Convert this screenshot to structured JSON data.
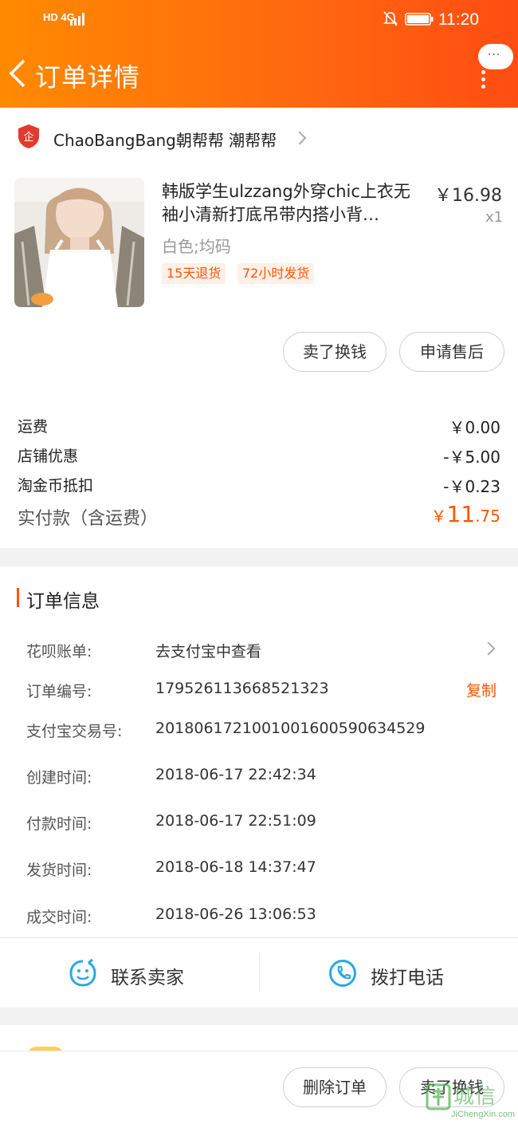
{
  "status_bar": {
    "left_text": "HD 4G",
    "time": "11:20"
  },
  "header": {
    "title": "订单详情",
    "more_label": "···"
  },
  "shop": {
    "name": "ChaoBangBang朝帮帮 潮帮帮"
  },
  "product": {
    "title": "韩版学生ulzzang外穿chic上衣无袖小清新打底吊带内搭小背…",
    "price": "￥16.98",
    "qty": "x1",
    "sku": "白色;均码",
    "tags": [
      "15天退货",
      "72小时发货"
    ]
  },
  "product_actions": [
    "卖了换钱",
    "申请售后"
  ],
  "fees": [
    {
      "label": "运费",
      "value": "￥0.00"
    },
    {
      "label": "店铺优惠",
      "value": "-￥5.00"
    },
    {
      "label": "淘金币抵扣",
      "value": "-￥0.23"
    }
  ],
  "total": {
    "label": "实付款（含运费）",
    "currency": "￥",
    "integer": "11",
    "decimal": ".75"
  },
  "order_info": {
    "title": "订单信息",
    "rows": [
      {
        "label": "花呗账单:",
        "value": "去支付宝中查看"
      },
      {
        "label": "订单编号:",
        "value": "179526113668521323"
      },
      {
        "label": "支付宝交易号:",
        "value": "2018061721001001600590634529"
      },
      {
        "label": "创建时间:",
        "value": "2018-06-17 22:42:34"
      },
      {
        "label": "付款时间:",
        "value": "2018-06-17 22:51:09"
      },
      {
        "label": "发货时间:",
        "value": "2018-06-18 14:37:47"
      },
      {
        "label": "成交时间:",
        "value": "2018-06-26 13:06:53"
      }
    ],
    "copy_label": "复制"
  },
  "contact": {
    "seller": "联系卖家",
    "call": "拨打电话"
  },
  "bottom_actions": [
    "删除订单",
    "卖了换钱"
  ],
  "watermark": {
    "text": "城信",
    "sub": "JiChengXin.com"
  },
  "colors": {
    "accent": "#ff5500",
    "header_start": "#ff8a00",
    "header_end": "#ff4d12",
    "link_blue": "#29a9e1"
  }
}
